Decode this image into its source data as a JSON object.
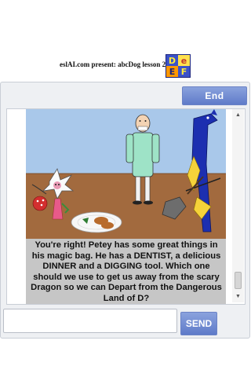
{
  "header": {
    "title": "eslAI.com present: abcDog lesson 2",
    "logo_letters": [
      "D",
      "e",
      "E",
      "F"
    ]
  },
  "toolbar": {
    "end_label": "End"
  },
  "chat": {
    "message": "You're right! Petey has some great things in his magic bag. He has a DENTIST, a delicious DINNER and a DIGGING tool. Which one should we use to get us away from the scary Dragon so we can Depart from the Dangerous Land of D?"
  },
  "composer": {
    "input_value": "",
    "send_label": "SEND"
  },
  "colors": {
    "button_blue": "#6f88d0",
    "scene_sky": "#a9c8ea",
    "scene_ground": "#a26a3e",
    "dentist_coat": "#9ee3c7",
    "dragon_blue": "#1c2fb0"
  },
  "icons": [
    "logo-icon",
    "scroll-up-icon",
    "scroll-down-icon"
  ]
}
